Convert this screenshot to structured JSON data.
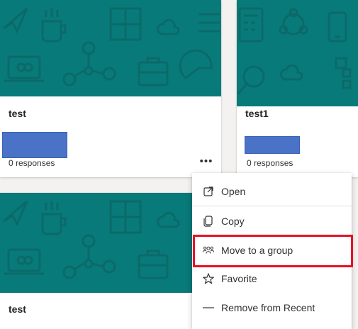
{
  "cards": [
    {
      "title": "test",
      "responses": "0 responses"
    },
    {
      "title": "test1",
      "responses": "0 responses"
    },
    {
      "title": "test"
    }
  ],
  "more_button": {
    "label": "•••",
    "icon": "more-horizontal-icon"
  },
  "context_menu": {
    "items": [
      {
        "label": "Open",
        "icon": "open-external-icon"
      },
      {
        "label": "Copy",
        "icon": "copy-icon"
      },
      {
        "label": "Move to a group",
        "icon": "group-icon"
      },
      {
        "label": "Favorite",
        "icon": "star-icon"
      },
      {
        "label": "Remove from Recent",
        "icon": "dash-icon"
      }
    ]
  },
  "colors": {
    "banner": "#087a79",
    "banner_pattern": "#0b6a69",
    "redaction": "#4a73c8",
    "highlight": "#e81123"
  }
}
